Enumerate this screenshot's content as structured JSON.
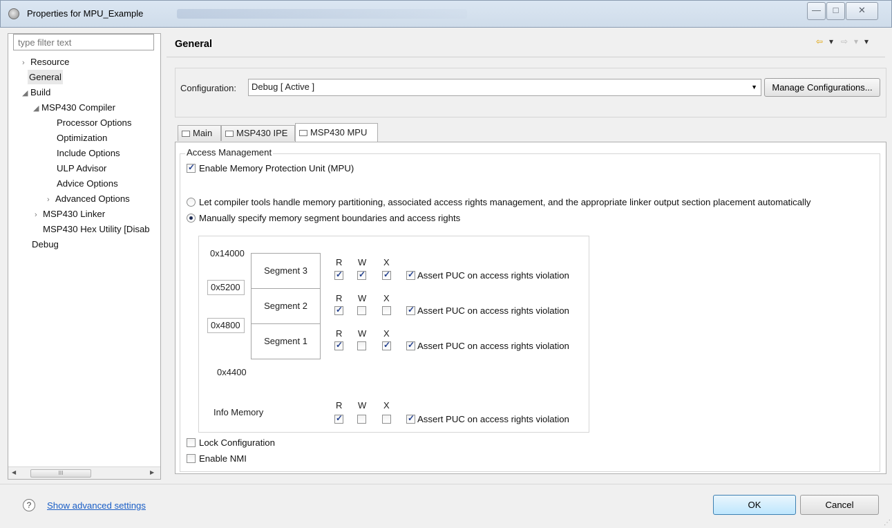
{
  "window": {
    "title": "Properties for MPU_Example",
    "minimize_glyph": "—",
    "maximize_glyph": "□",
    "close_glyph": "✕"
  },
  "sidebar": {
    "filter_placeholder": "type filter text",
    "items": [
      {
        "label": "Resource",
        "arrow": "›"
      },
      {
        "label": "General",
        "arrow": ""
      },
      {
        "label": "Build",
        "arrow": "◢"
      },
      {
        "label": "MSP430 Compiler",
        "arrow": "◢"
      },
      {
        "label": "Processor Options",
        "arrow": ""
      },
      {
        "label": "Optimization",
        "arrow": ""
      },
      {
        "label": "Include Options",
        "arrow": ""
      },
      {
        "label": "ULP Advisor",
        "arrow": ""
      },
      {
        "label": "Advice Options",
        "arrow": ""
      },
      {
        "label": "Advanced Options",
        "arrow": "›"
      },
      {
        "label": "MSP430 Linker",
        "arrow": "›"
      },
      {
        "label": "MSP430 Hex Utility  [Disab",
        "arrow": ""
      },
      {
        "label": "Debug",
        "arrow": ""
      }
    ],
    "scroll_thumb_label": "III",
    "scroll_left": "◀",
    "scroll_right": "▶"
  },
  "header": {
    "title": "General",
    "nav_back": "⇦",
    "nav_back_menu": "▾",
    "nav_forward": "⇨",
    "nav_forward_menu": "▾",
    "view_menu": "▾"
  },
  "configuration": {
    "label": "Configuration:",
    "selected": "Debug  [ Active ]",
    "dropdown_arrow": "▼",
    "manage_button": "Manage Configurations..."
  },
  "tabs": [
    {
      "label": "Main"
    },
    {
      "label": "MSP430 IPE"
    },
    {
      "label": "MSP430 MPU"
    }
  ],
  "access_management": {
    "legend": "Access Management",
    "enable_mpu": {
      "label": "Enable Memory Protection Unit (MPU)",
      "checked": true
    },
    "radio_auto": {
      "label": "Let compiler tools handle memory partitioning, associated access rights management, and the appropriate linker output section placement automatically",
      "checked": false
    },
    "radio_manual": {
      "label": "Manually specify memory segment boundaries and access rights",
      "checked": true
    },
    "top_address": "0x14000",
    "bottom_address": "0x4400",
    "boundary_1": "0x5200",
    "boundary_2": "0x4800",
    "rwx_labels": {
      "r": "R",
      "w": "W",
      "x": "X"
    },
    "segments": [
      {
        "name": "Segment 3",
        "r": true,
        "w": true,
        "x": true,
        "assert_puc": true
      },
      {
        "name": "Segment 2",
        "r": true,
        "w": false,
        "x": false,
        "assert_puc": true
      },
      {
        "name": "Segment 1",
        "r": true,
        "w": false,
        "x": true,
        "assert_puc": true
      }
    ],
    "info_memory": {
      "name": "Info Memory",
      "r": true,
      "w": false,
      "x": false,
      "assert_puc": true
    },
    "assert_puc_label": "Assert PUC on access rights violation",
    "lock_configuration": {
      "label": "Lock Configuration",
      "checked": false
    },
    "enable_nmi": {
      "label": "Enable NMI",
      "checked": false
    }
  },
  "footer": {
    "help_glyph": "?",
    "advanced_link": "Show advanced settings",
    "ok_button": "OK",
    "cancel_button": "Cancel",
    "resize_glyph": "⋰"
  },
  "colors": {
    "accent_link": "#1a5ec6",
    "nav_arrow": "#e0a000",
    "check": "#23408e"
  }
}
